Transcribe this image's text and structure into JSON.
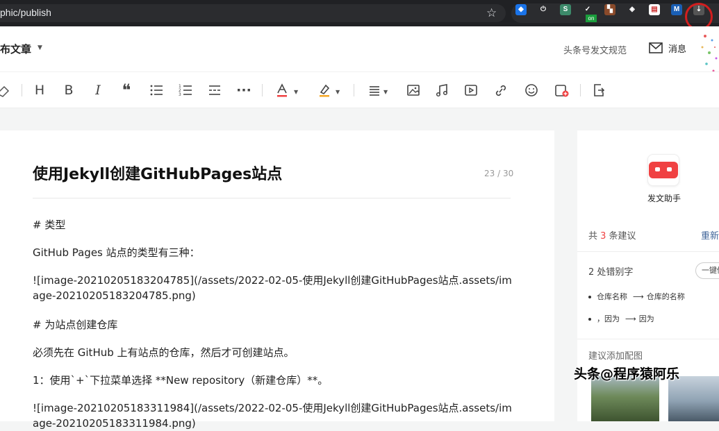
{
  "browser": {
    "url": "phic/publish",
    "extensions": [
      {
        "name": "compass-extension-icon",
        "color": "#1a73e8",
        "glyph": "◆"
      },
      {
        "name": "power-extension-icon",
        "color": "#2b2c2f",
        "glyph": "⏻"
      },
      {
        "name": "s-extension-icon",
        "color": "#3c8a6a",
        "glyph": "S"
      },
      {
        "name": "check-extension-icon",
        "color": "#2b2c2f",
        "glyph": "✓"
      },
      {
        "name": "ruler-extension-icon",
        "color": "#8a4a2a",
        "glyph": "▚"
      },
      {
        "name": "translate-extension-icon",
        "color": "#2b2c2f",
        "glyph": "◈"
      },
      {
        "name": "note-extension-icon",
        "color": "#ffffff",
        "glyph": "▤"
      },
      {
        "name": "m-extension-icon",
        "color": "#1a5fb4",
        "glyph": "M"
      },
      {
        "name": "save-extension-icon",
        "color": "#555555",
        "glyph": "⇣"
      }
    ],
    "ext_badge": "on"
  },
  "header": {
    "publish_title": "布文章",
    "rules_link": "头条号发文规范",
    "messages_label": "消息"
  },
  "toolbar": {
    "heading_glyph": "H",
    "bold_glyph": "B",
    "italic_glyph": "I",
    "quote_glyph": "❝",
    "more_glyph": "···"
  },
  "editor": {
    "title": "使用Jekyll创建GitHubPages站点",
    "title_count": "23 / 30",
    "paragraphs": [
      "# 类型",
      "GitHub Pages 站点的类型有三种：",
      "![image-20210205183204785](/assets/2022-02-05-使用Jekyll创建GitHubPages站点.assets/image-20210205183204785.png)",
      "# 为站点创建仓库",
      "必须先在 GitHub 上有站点的仓库，然后才可创建站点。",
      "1：使用`+`下拉菜单选择 **New repository（新建仓库）**。",
      "![image-20210205183311984](/assets/2022-02-05-使用Jekyll创建GitHubPages站点.assets/image-20210205183311984.png)"
    ]
  },
  "assistant": {
    "name": "发文助手",
    "sug_prefix": "共 ",
    "sug_num": "3",
    "sug_suffix": " 条建议",
    "refresh": "重新检测",
    "typo_head": "2 处错别字",
    "one_click": "一键修改",
    "typos": [
      {
        "from": "仓库名称",
        "to": "仓库的名称"
      },
      {
        "from": "，因为",
        "to": "因为"
      }
    ],
    "image_suggestion": "建议添加配图"
  },
  "watermark": "头条@程序猿阿乐",
  "colors": {
    "accent_red": "#f04142",
    "link_blue": "#406599"
  }
}
